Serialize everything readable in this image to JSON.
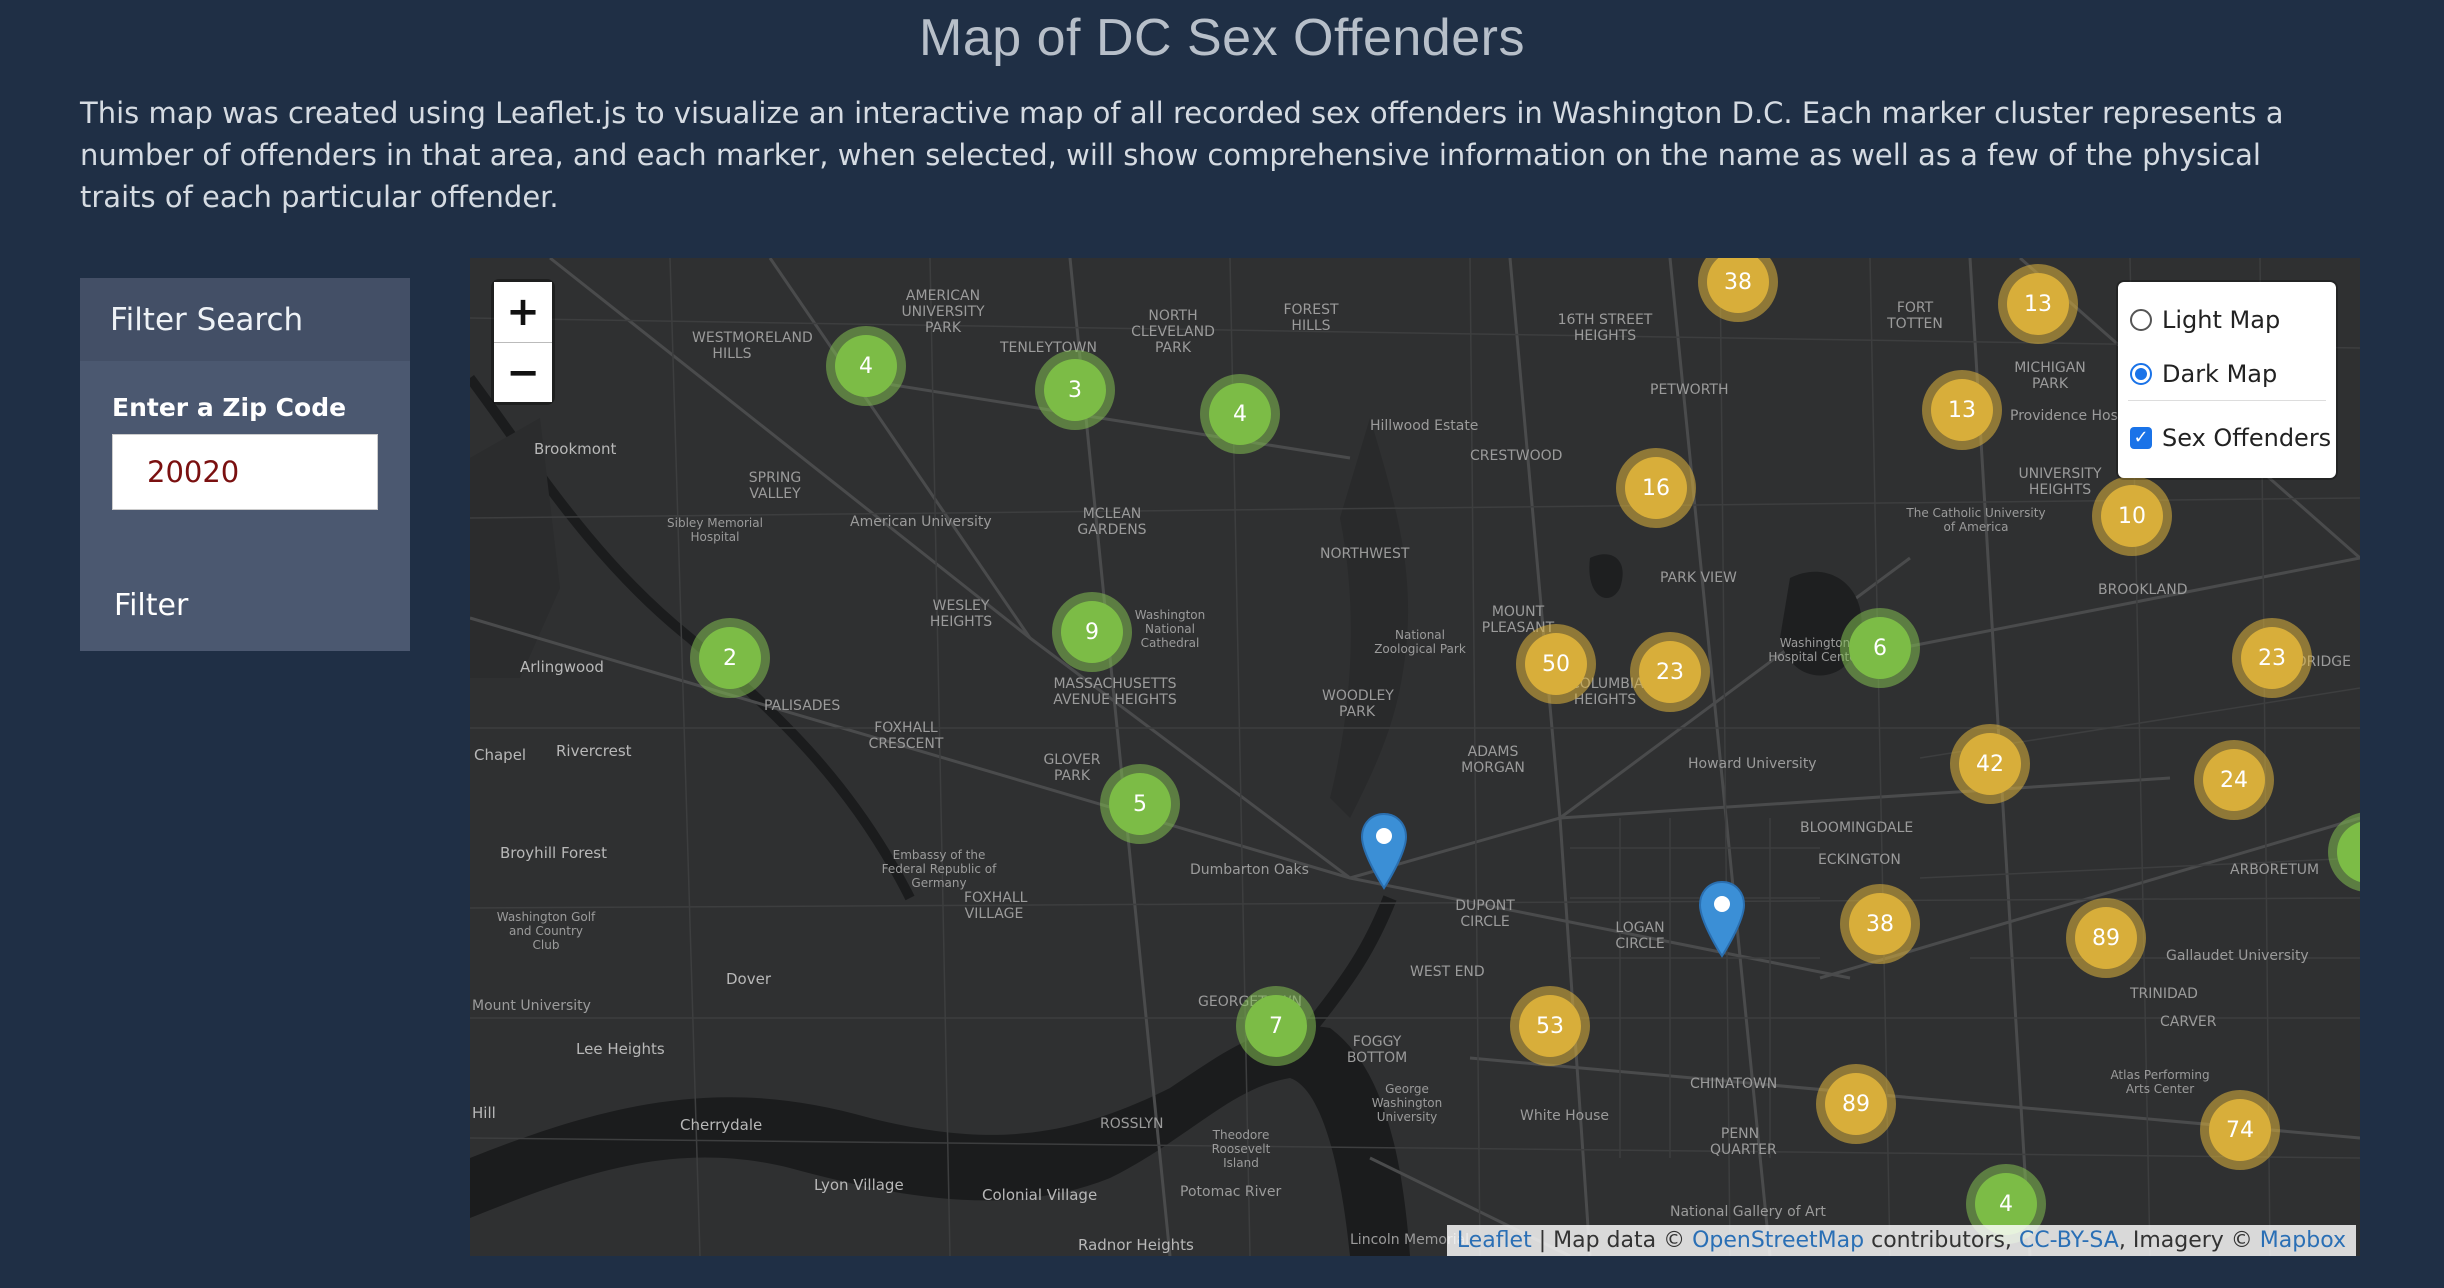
{
  "page": {
    "title": "Map of DC Sex Offenders",
    "intro": "This map was created using Leaflet.js to visualize an interactive map of all recorded sex offenders in Washington D.C. Each marker cluster represents a number of offenders in that area, and each marker, when selected, will show comprehensive information on the name as well as a few of the physical traits of each particular offender."
  },
  "filter": {
    "heading": "Filter Search",
    "zip_label": "Enter a Zip Code",
    "zip_value": "20020",
    "button_label": "Filter"
  },
  "map": {
    "zoom_in": "+",
    "zoom_out": "−",
    "layers": {
      "light": "Light Map",
      "dark": "Dark Map",
      "selected_base": "Dark Map",
      "overlay": "Sex Offenders",
      "overlay_checked": true
    },
    "colors": {
      "small_cluster": "#7cbc46",
      "medium_cluster": "#d8ae3a",
      "marker": "#3b8fd6"
    },
    "clusters": [
      "38",
      "13",
      "4",
      "3",
      "4",
      "13",
      "16",
      "10",
      "9",
      "2",
      "50",
      "23",
      "6",
      "23",
      "42",
      "24",
      "5",
      "38",
      "89",
      "7",
      "53",
      "89",
      "74",
      "4"
    ],
    "place_labels": [
      "AMERICAN UNIVERSITY PARK",
      "WESTMORELAND HILLS",
      "TENLEYTOWN",
      "NORTH CLEVELAND PARK",
      "FOREST HILLS",
      "16TH STREET HEIGHTS",
      "FORT TOTTEN",
      "MICHIGAN PARK",
      "Brookmont",
      "SPRING VALLEY",
      "American University",
      "CRESTWOOD",
      "PETWORTH",
      "UNIVERSITY HEIGHTS",
      "Sibley Memorial Hospital",
      "MCLEAN GARDENS",
      "NORTHWEST",
      "PARK VIEW",
      "BROOKLAND",
      "WESLEY HEIGHTS",
      "MOUNT PLEASANT",
      "Arlingwood",
      "PALISADES",
      "MASSACHUSETTS AVENUE HEIGHTS",
      "WOODLEY PARK",
      "COLUMBIA HEIGHTS",
      "Howard University",
      "Rivercrest",
      "FOXHALL CRESCENT",
      "GLOVER PARK",
      "ADAMS MORGAN",
      "BLOOMINGDALE",
      "WOODRIDGE",
      "Broyhill Forest",
      "Embassy of the Federal Republic of Germany",
      "FOXHALL VILLAGE",
      "DUPONT CIRCLE",
      "LOGAN CIRCLE",
      "ECKINGTON",
      "ARBORETUM",
      "TRINIDAD",
      "Dover",
      "GEORGETOWN",
      "WEST END",
      "Lee Heights",
      "FOGGY BOTTOM",
      "CHINATOWN",
      "CARVER",
      "Cherrydale",
      "ROSSLYN",
      "PENN QUARTER",
      "Lyon Village",
      "Colonial Village",
      "White House",
      "Radnor Heights",
      "Hillwood Estate",
      "National Zoological Park",
      "Washington Hospital Center",
      "Gallaudet University",
      "Atlas Performing Arts Center",
      "The Catholic University of America",
      "Providence Hospital",
      "Dumbarton Oaks",
      "Washington National Cathedral",
      "George Washington University",
      "Theodore Roosevelt Island",
      "Potomac River",
      "Washington Golf and Country Club",
      "National Gallery of Art",
      "Lincoln Memorial",
      "Chapel",
      "Mount University",
      "Hill"
    ],
    "attribution": {
      "leaflet": "Leaflet",
      "sep": " | Map data © ",
      "osm": "OpenStreetMap",
      "mid": " contributors, ",
      "license": "CC-BY-SA",
      "imagery": ", Imagery © ",
      "provider": "Mapbox"
    }
  }
}
